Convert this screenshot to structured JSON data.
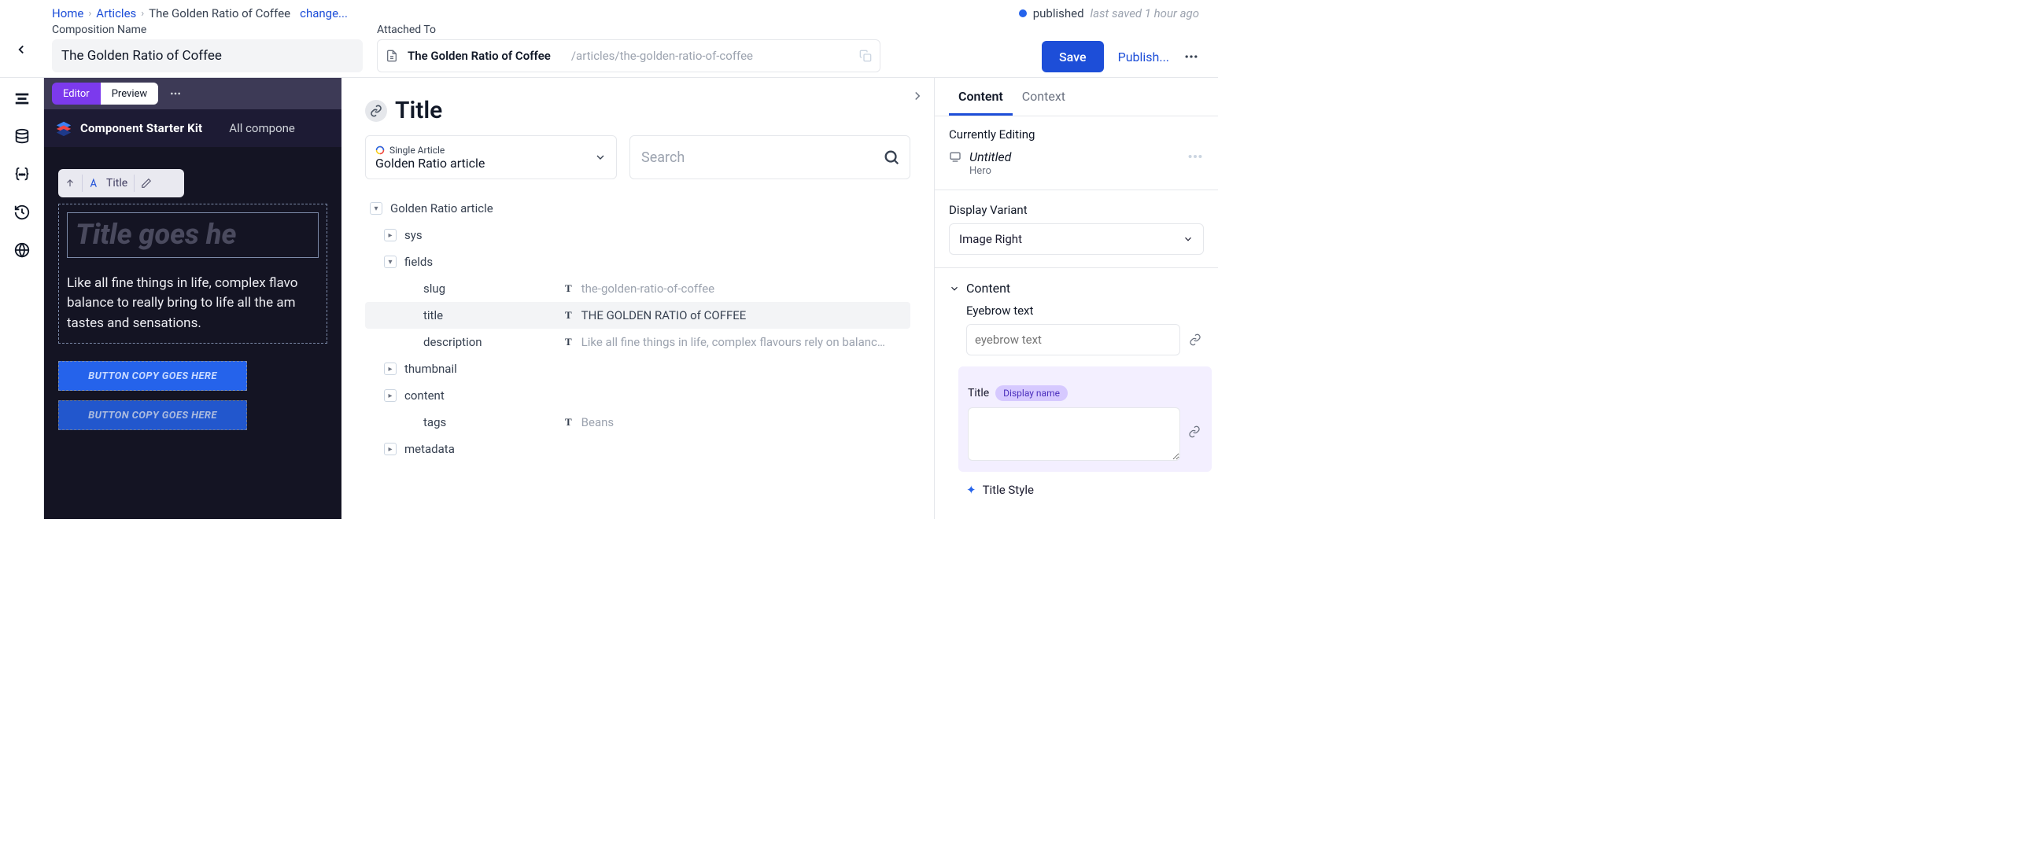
{
  "breadcrumb": {
    "home": "Home",
    "articles": "Articles",
    "current": "The Golden Ratio of Coffee",
    "change": "change..."
  },
  "status": {
    "label": "published",
    "last_saved": "last saved 1 hour ago"
  },
  "composition": {
    "name_label": "Composition Name",
    "name_value": "The Golden Ratio of Coffee",
    "attached_label": "Attached To",
    "attached_title": "The Golden Ratio of Coffee",
    "attached_path": "/articles/the-golden-ratio-of-coffee"
  },
  "actions": {
    "save": "Save",
    "publish": "Publish..."
  },
  "canvas": {
    "tab_editor": "Editor",
    "tab_preview": "Preview",
    "brand": "Component Starter Kit",
    "nav1": "All compone",
    "minitool_label": "Title",
    "title_placeholder": "Title goes he",
    "description": "Like all fine things in life, complex flavo\nbalance to really bring to life all the am\ntastes and sensations.",
    "cta": "BUTTON COPY GOES HERE",
    "cta2": "BUTTON COPY GOES HERE"
  },
  "middle": {
    "title": "Title",
    "ds_kicker": "Single Article",
    "ds_value": "Golden Ratio article",
    "search_ph": "Search",
    "tree": {
      "root": "Golden Ratio article",
      "sys": "sys",
      "fields": "fields",
      "slug_k": "slug",
      "slug_v": "the-golden-ratio-of-coffee",
      "title_k": "title",
      "title_v": "THE GOLDEN RATIO of COFFEE",
      "desc_k": "description",
      "desc_v": "Like all fine things in life, complex flavours rely on balanc…",
      "thumb_k": "thumbnail",
      "content_k": "content",
      "tags_k": "tags",
      "tags_v": "Beans",
      "metadata": "metadata"
    }
  },
  "right": {
    "tab_content": "Content",
    "tab_context": "Context",
    "currently_editing": "Currently Editing",
    "editing_title": "Untitled",
    "editing_type": "Hero",
    "display_variant_label": "Display Variant",
    "display_variant_value": "Image Right",
    "group_content": "Content",
    "eyebrow_label": "Eyebrow text",
    "eyebrow_ph": "eyebrow text",
    "title_label": "Title",
    "display_name_badge": "Display name",
    "title_style_label": "Title Style"
  }
}
